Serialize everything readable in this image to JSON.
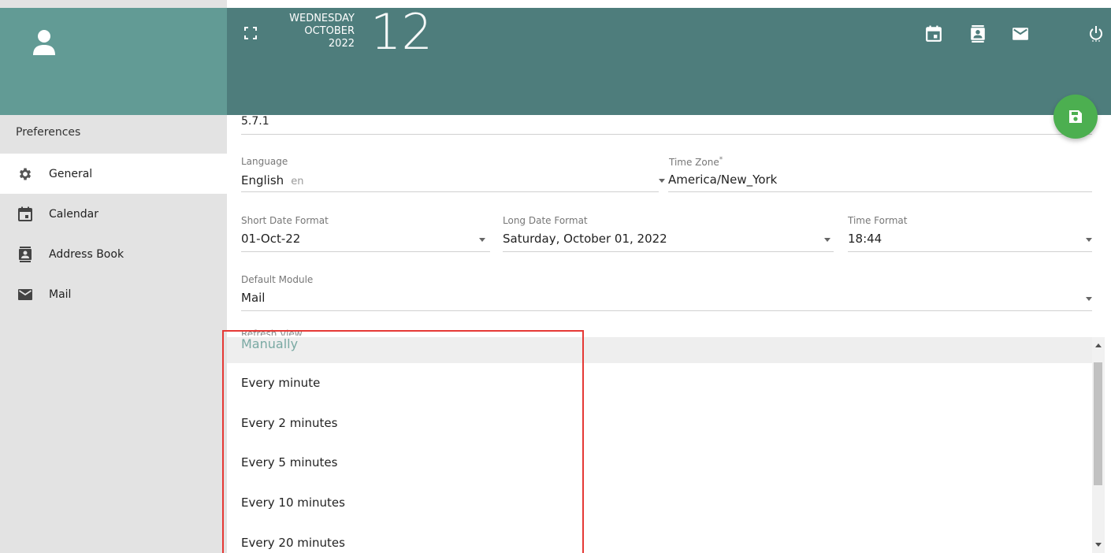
{
  "header": {
    "weekday": "WEDNESDAY",
    "month": "OCTOBER",
    "year": "2022",
    "day": "12"
  },
  "sidebar": {
    "title": "Preferences",
    "items": [
      {
        "label": "General",
        "icon": "gear-icon",
        "active": true
      },
      {
        "label": "Calendar",
        "icon": "calendar-icon",
        "active": false
      },
      {
        "label": "Address Book",
        "icon": "address-book-icon",
        "active": false
      },
      {
        "label": "Mail",
        "icon": "mail-icon",
        "active": false
      }
    ]
  },
  "form": {
    "version": "5.7.1",
    "language": {
      "label": "Language",
      "value": "English",
      "code": "en"
    },
    "time_zone": {
      "label": "Time Zone",
      "required_mark": "*",
      "value": "America/New_York"
    },
    "short_date": {
      "label": "Short Date Format",
      "value": "01-Oct-22"
    },
    "long_date": {
      "label": "Long Date Format",
      "value": "Saturday, October 01, 2022"
    },
    "time_format": {
      "label": "Time Format",
      "value": "18:44"
    },
    "default_module": {
      "label": "Default Module",
      "value": "Mail"
    },
    "refresh_view": {
      "label": "Refresh View"
    }
  },
  "refresh_options": [
    "Manually",
    "Every minute",
    "Every 2 minutes",
    "Every 5 minutes",
    "Every 10 minutes",
    "Every 20 minutes"
  ],
  "colors": {
    "header_bg": "#4e7d7c",
    "sidebar_header_bg": "#629b95",
    "save_fab": "#4caf50",
    "highlight_box": "#e53935"
  }
}
